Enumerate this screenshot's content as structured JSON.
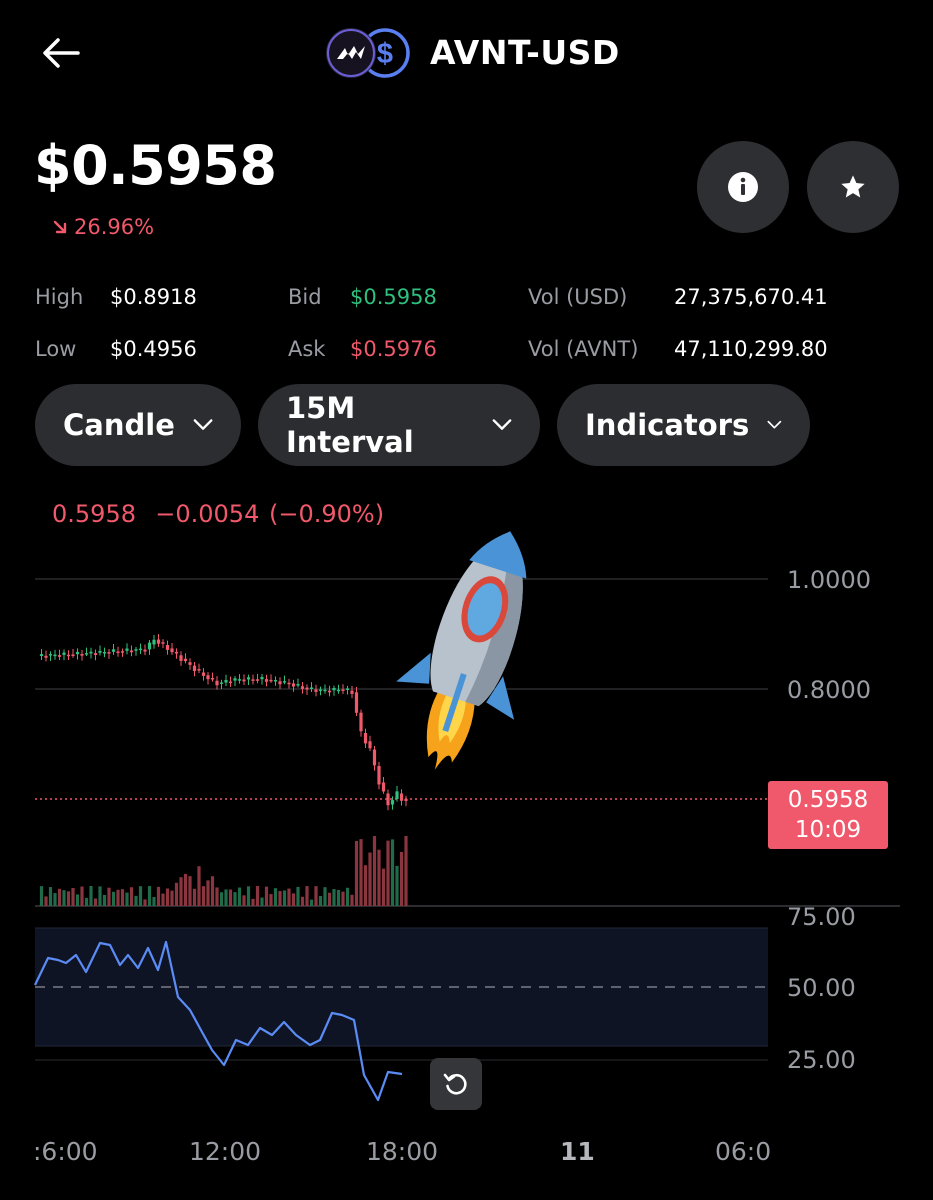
{
  "header": {
    "back_icon": "arrow-left-icon",
    "logo_icon": "avnt-usd-pair-logo",
    "title": "AVNT-USD"
  },
  "price": {
    "current": "$0.5958",
    "change_percent": "26.96%",
    "change_direction": "down",
    "change_color": "#f0596b"
  },
  "actions": {
    "info_icon": "info-icon",
    "favorite_icon": "star-icon"
  },
  "stats": {
    "high_label": "High",
    "high_value": "$0.8918",
    "low_label": "Low",
    "low_value": "$0.4956",
    "bid_label": "Bid",
    "bid_value": "$0.5958",
    "ask_label": "Ask",
    "ask_value": "$0.5976",
    "vol_usd_label": "Vol (USD)",
    "vol_usd_value": "27,375,670.41",
    "vol_base_label": "Vol (AVNT)",
    "vol_base_value": "47,110,299.80"
  },
  "controls": {
    "chart_type": "Candle",
    "interval": "15M Interval",
    "indicators": "Indicators"
  },
  "ohlc_readout": {
    "price": "0.5958",
    "change": "−0.0054",
    "change_percent": "(−0.90%)"
  },
  "chart": {
    "price_axis": [
      "1.0000",
      "0.8000"
    ],
    "current_price_tag": "0.5958",
    "countdown": "10:09",
    "rsi_axis": [
      "75.00",
      "50.00",
      "25.00"
    ],
    "time_axis": [
      ":6:00",
      "12:00",
      "18:00",
      "11",
      "06:0"
    ],
    "overlay_sticker": "rocket-emoji",
    "reset_icon": "reset-zoom-icon",
    "up_color": "#2fbf7e",
    "down_color": "#f0596b",
    "rsi_color": "#5b8cf5"
  }
}
